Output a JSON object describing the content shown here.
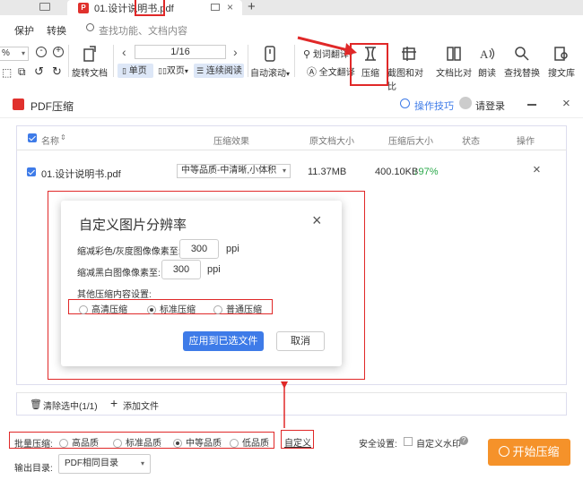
{
  "tabs": {
    "file_tab": "01.设计说明书.pdf",
    "add_tab": "+"
  },
  "menu": {
    "items": [
      "保护",
      "转换"
    ],
    "search_placeholder": "查找功能、文档内容"
  },
  "toolbar": {
    "zoom_value": "%",
    "rotate_label": "旋转文档",
    "page_input": "1/16",
    "single_label": "单页",
    "double_label": "双页",
    "continuous_label": "连续阅读",
    "autoscroll_label": "自动滚动",
    "translate_label": "划词翻译",
    "fulltext_translate_label": "全文翻译",
    "compress_label": "压缩",
    "screenshot_label": "截图和对比",
    "compare_label": "文档比对",
    "read_label": "朗读",
    "find_replace_label": "查找替换",
    "search_lib_label": "搜文库"
  },
  "dialog": {
    "title": "PDF压缩",
    "tips_label": "操作技巧",
    "login_label": "请登录",
    "columns": [
      "名称",
      "压缩效果",
      "原文档大小",
      "压缩后大小",
      "状态",
      "操作"
    ],
    "rows": [
      {
        "name": "01.设计说明书.pdf",
        "effect": "中等品质-中清晰,小体积",
        "original_size": "11.37MB",
        "compressed_size": "400.10KB",
        "ratio": "↓97%"
      }
    ],
    "clear_selected": "清除选中(1/1)",
    "add_file": "添加文件",
    "batch_label": "批量压缩:",
    "batch_options": [
      "高品质",
      "标准品质",
      "中等品质",
      "低品质"
    ],
    "batch_selected": 2,
    "custom_link": "自定义",
    "security_label": "安全设置:",
    "watermark_label": "自定义水印",
    "start_button": "开始压缩",
    "output_label": "输出目录:",
    "output_value": "PDF相同目录"
  },
  "popup": {
    "title": "自定义图片分辨率",
    "color_label": "缩减彩色/灰度图像像素至:",
    "color_value": "300",
    "bw_label": "缩减黑白图像像素至:",
    "bw_value": "300",
    "unit": "ppi",
    "other_label": "其他压缩内容设置:",
    "options": [
      "高清压缩",
      "标准压缩",
      "普通压缩"
    ],
    "selected": 1,
    "apply_button": "应用到已选文件",
    "cancel_button": "取消"
  },
  "colors": {
    "accent": "#3e7be8",
    "annotation": "#e02828",
    "start": "#f5922a",
    "success": "#2aa84a"
  }
}
